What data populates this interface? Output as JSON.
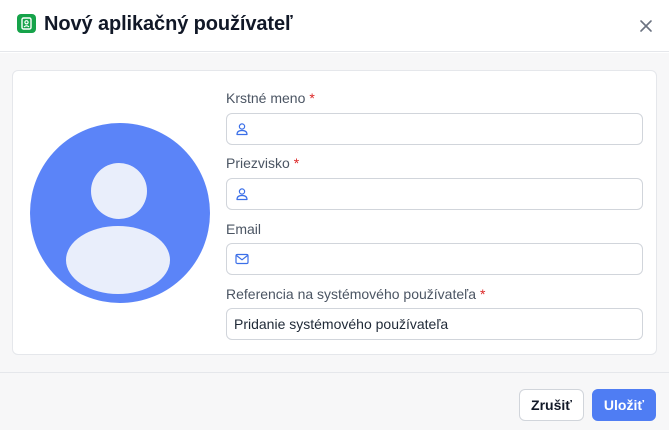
{
  "dialog": {
    "title": "Nový aplikačný používateľ",
    "accent_color": "#16a34a"
  },
  "form": {
    "first_name": {
      "label": "Krstné meno",
      "required": "*",
      "value": ""
    },
    "last_name": {
      "label": "Priezvisko",
      "required": "*",
      "value": ""
    },
    "email": {
      "label": "Email",
      "value": ""
    },
    "system_user_ref": {
      "label": "Referencia na systémového používateľa",
      "required": "*",
      "value": "Pridanie systémového používateľa"
    }
  },
  "footer": {
    "cancel_label": "Zrušiť",
    "save_label": "Uložiť",
    "primary_color": "#4f7df3"
  },
  "icons": {
    "app": "contact-card-icon",
    "close": "close-icon",
    "first_name": "user-icon",
    "last_name": "user-icon",
    "email": "mail-icon",
    "avatar": "avatar-placeholder"
  }
}
